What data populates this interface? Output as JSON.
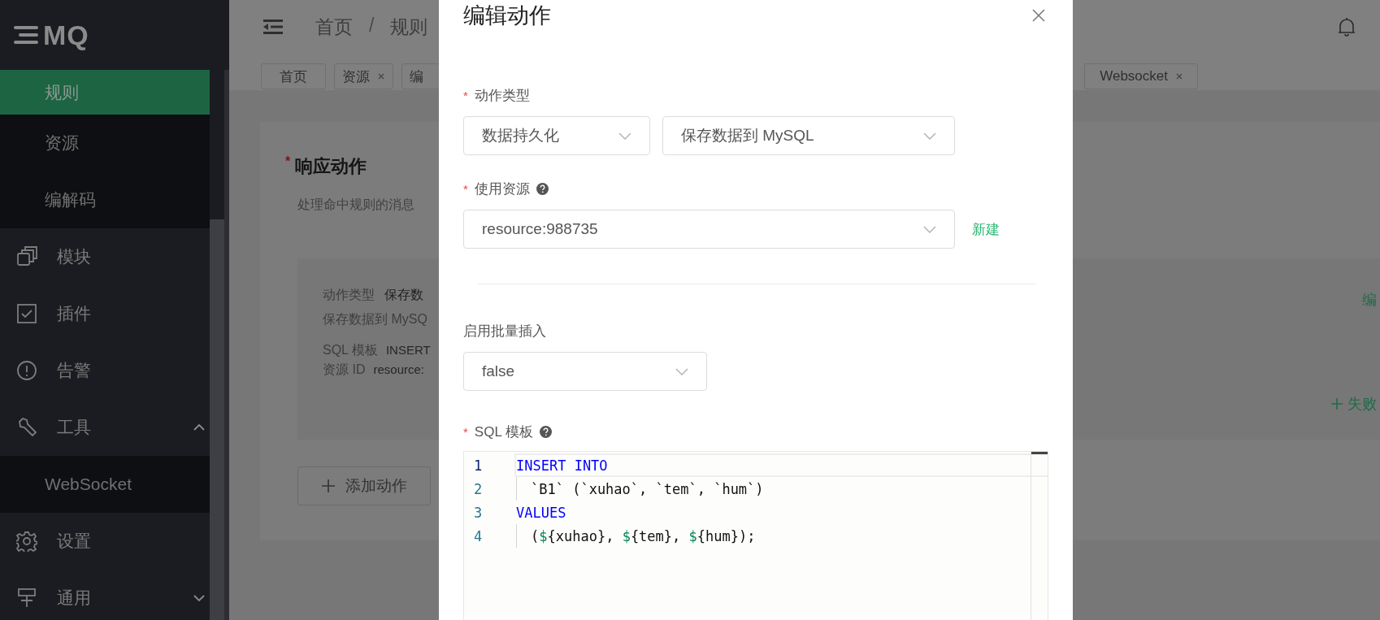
{
  "sidebar": {
    "logo": "MQ",
    "items": [
      {
        "label": "规则",
        "kind": "sub",
        "selected": true
      },
      {
        "label": "资源",
        "kind": "sub",
        "selected": false
      },
      {
        "label": "编解码",
        "kind": "sub",
        "selected": false
      },
      {
        "label": "模块",
        "kind": "link",
        "selected": false
      },
      {
        "label": "插件",
        "kind": "link",
        "selected": false
      },
      {
        "label": "告警",
        "kind": "link",
        "selected": false
      },
      {
        "label": "工具",
        "kind": "group",
        "selected": false,
        "expanded": true,
        "children": [
          {
            "label": "WebSocket",
            "selected": false
          }
        ]
      },
      {
        "label": "设置",
        "kind": "link",
        "selected": false
      },
      {
        "label": "通用",
        "kind": "group",
        "selected": false,
        "expanded": false
      }
    ]
  },
  "header": {
    "breadcrumb": [
      "首页",
      "/",
      "规则"
    ]
  },
  "tags_left": [
    {
      "label": "首页",
      "closable": false
    },
    {
      "label": "资源",
      "closable": true
    },
    {
      "label": "编",
      "closable": false
    }
  ],
  "tags_right": [
    {
      "label": "Websocket",
      "closable": true
    }
  ],
  "card": {
    "title": "响应动作",
    "required_mark": "*",
    "description": "处理命中规则的消息",
    "action": {
      "type_label": "动作类型",
      "type_value": "保存数",
      "description": "保存数据到 MySQ",
      "params": [
        {
          "label": "SQL 模板",
          "value": "INSERT"
        },
        {
          "label": "资源 ID",
          "value": "resource:"
        }
      ],
      "edit_link": "编",
      "fallback_link": "失败"
    },
    "add_button": "添加动作"
  },
  "dialog": {
    "title": "编辑动作",
    "action_type": {
      "label": "动作类型",
      "required_mark": "*",
      "values": [
        "数据持久化",
        "保存数据到 MySQL"
      ]
    },
    "resource": {
      "label": "使用资源",
      "required_mark": "*",
      "help": true,
      "value": "resource:988735",
      "new_link": "新建"
    },
    "batch_insert": {
      "label": "启用批量插入",
      "value": "false"
    },
    "sql_template": {
      "label": "SQL 模板",
      "required_mark": "*",
      "help": true,
      "lines": [
        {
          "number": "1",
          "indented": false,
          "current": true,
          "tokens": [
            {
              "kind": "keyword",
              "text": "INSERT INTO"
            }
          ]
        },
        {
          "number": "2",
          "indented": true,
          "current": false,
          "tokens": [
            {
              "kind": "text",
              "text": "`B1` (`xuhao`, `tem`, `hum`)"
            }
          ]
        },
        {
          "number": "3",
          "indented": false,
          "current": false,
          "tokens": [
            {
              "kind": "keyword",
              "text": "VALUES"
            }
          ]
        },
        {
          "number": "4",
          "indented": true,
          "current": false,
          "tokens": [
            {
              "kind": "text",
              "text": "("
            },
            {
              "kind": "variable",
              "text": "$"
            },
            {
              "kind": "text",
              "text": "{xuhao}, "
            },
            {
              "kind": "variable",
              "text": "$"
            },
            {
              "kind": "text",
              "text": "{tem}, "
            },
            {
              "kind": "variable",
              "text": "$"
            },
            {
              "kind": "text",
              "text": "{hum});"
            }
          ]
        }
      ]
    }
  }
}
